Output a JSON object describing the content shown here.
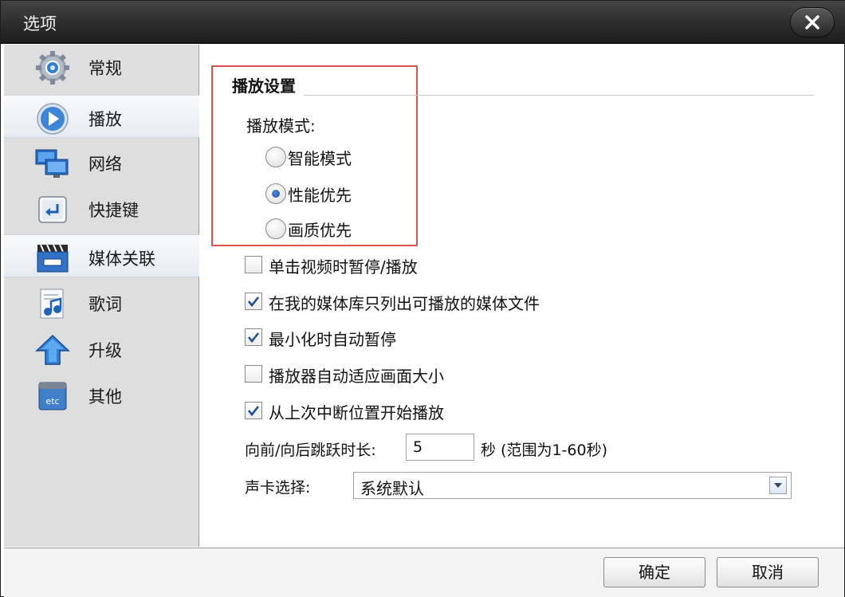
{
  "window": {
    "title": "选项"
  },
  "sidebar": {
    "items": [
      {
        "label": "常规",
        "icon": "gear-icon"
      },
      {
        "label": "播放",
        "icon": "play-icon",
        "selected": true
      },
      {
        "label": "网络",
        "icon": "network-icon"
      },
      {
        "label": "快捷键",
        "icon": "enter-key-icon"
      },
      {
        "label": "媒体关联",
        "icon": "clapperboard-icon"
      },
      {
        "label": "歌词",
        "icon": "lyrics-icon"
      },
      {
        "label": "升级",
        "icon": "arrow-up-icon"
      },
      {
        "label": "其他",
        "icon": "etc-icon",
        "icon_text": "etc"
      }
    ]
  },
  "playback": {
    "section_title": "播放设置",
    "mode_label": "播放模式:",
    "modes": [
      {
        "label": "智能模式",
        "checked": false
      },
      {
        "label": "性能优先",
        "checked": true
      },
      {
        "label": "画质优先",
        "checked": false
      }
    ],
    "options": [
      {
        "label": "单击视频时暂停/播放",
        "checked": false
      },
      {
        "label": "在我的媒体库只列出可播放的媒体文件",
        "checked": true
      },
      {
        "label": "最小化时自动暂停",
        "checked": true
      },
      {
        "label": "播放器自动适应画面大小",
        "checked": false
      },
      {
        "label": "从上次中断位置开始播放",
        "checked": true
      }
    ],
    "seek": {
      "label": "向前/向后跳跃时长:",
      "value": "5",
      "suffix": "秒 (范围为1-60秒)"
    },
    "soundcard": {
      "label": "声卡选择:",
      "value": "系统默认"
    }
  },
  "footer": {
    "ok_label": "确定",
    "cancel_label": "取消"
  },
  "colors": {
    "titlebar": "#2a2a2a",
    "sidebar": "#dedede",
    "highlight": "#d9534f",
    "accent": "#1a4f9c"
  }
}
